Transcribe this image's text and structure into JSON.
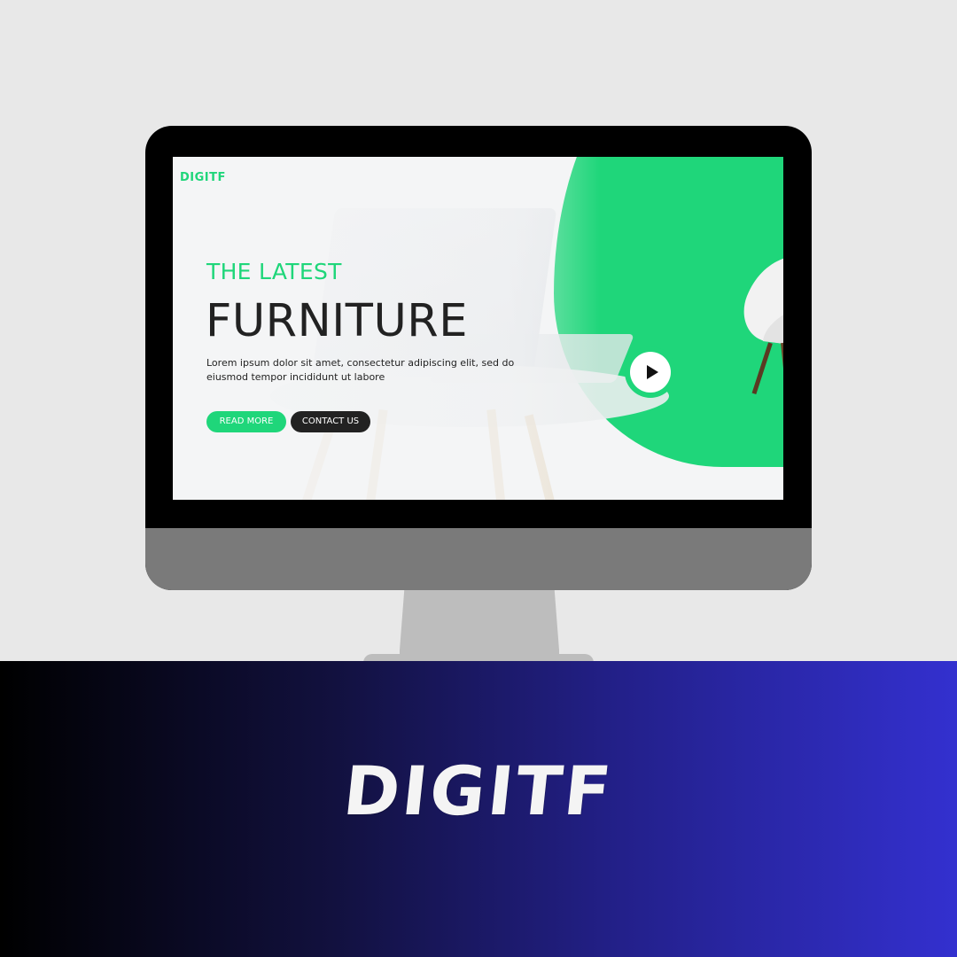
{
  "site": {
    "brand": "DIGITF",
    "eyebrow": "THE LATEST",
    "headline": "FURNITURE",
    "body": "Lorem ipsum dolor sit amet, consectetur adipiscing elit, sed do eiusmod tempor incididunt ut labore",
    "read_more_label": "READ MORE",
    "contact_label": "CONTACT US",
    "play_icon": "play-icon"
  },
  "banner": {
    "title": "DIGITF"
  },
  "colors": {
    "accent": "#1fd67a",
    "dark": "#222222",
    "banner_start": "#000000",
    "banner_end": "#3330cf",
    "background": "#e8e8e8"
  }
}
